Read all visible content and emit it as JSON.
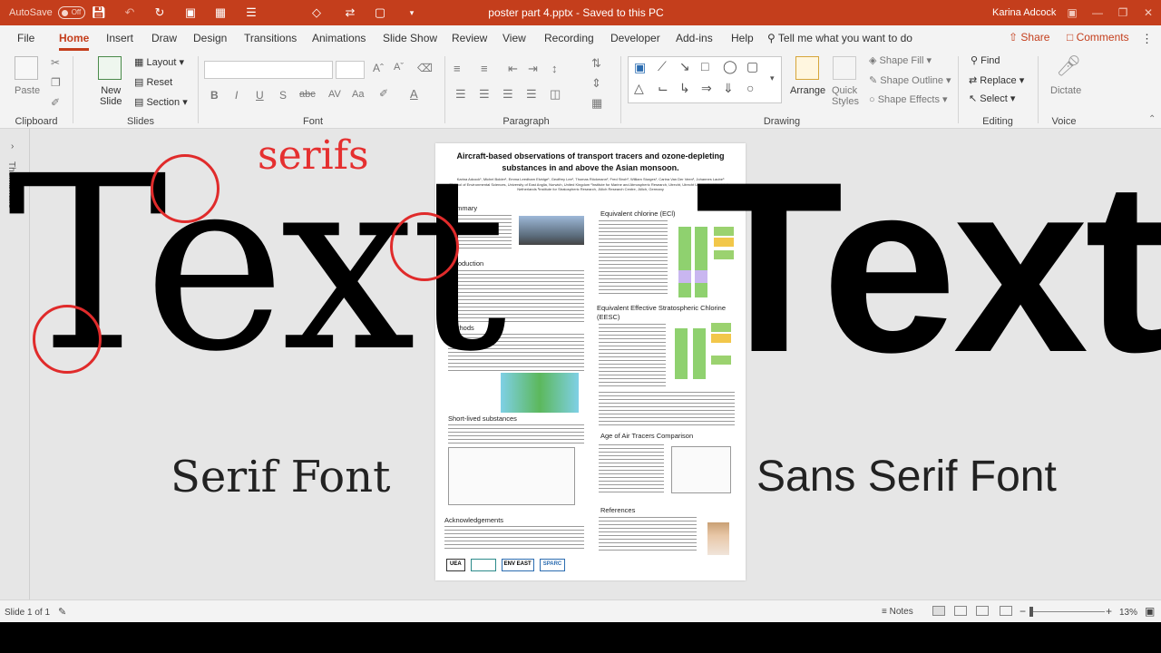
{
  "titlebar": {
    "autosave_label": "AutoSave",
    "autosave_state": "Off",
    "document_title": "poster part 4.pptx  -  Saved to this PC",
    "user_name": "Karina Adcock"
  },
  "tabs": [
    "File",
    "Home",
    "Insert",
    "Draw",
    "Design",
    "Transitions",
    "Animations",
    "Slide Show",
    "Review",
    "View",
    "Recording",
    "Developer",
    "Add-ins",
    "Help"
  ],
  "active_tab": "Home",
  "tell_me": "Tell me what you want to do",
  "share_label": "Share",
  "comments_label": "Comments",
  "ribbon": {
    "groups": {
      "clipboard": "Clipboard",
      "slides": "Slides",
      "font": "Font",
      "paragraph": "Paragraph",
      "drawing": "Drawing",
      "editing": "Editing",
      "voice": "Voice"
    },
    "paste": "Paste",
    "new_slide": "New\nSlide",
    "layout": "Layout",
    "reset": "Reset",
    "section": "Section",
    "arrange": "Arrange",
    "quick_styles": "Quick\nStyles",
    "shape_fill": "Shape Fill",
    "shape_outline": "Shape Outline",
    "shape_effects": "Shape Effects",
    "find": "Find",
    "replace": "Replace",
    "select": "Select",
    "dictate": "Dictate"
  },
  "thumbnails_label": "Thumbnails",
  "poster": {
    "title": "Aircraft-based observations of transport tracers and ozone-depleting substances in and above the Asian monsoon.",
    "authors": "Karina Adcock¹, Michel Bolder¹, Emma Leedham Elvidge¹, Geoffrey Lee¹, Thomas Röckmann², Fred Stroh³, William Sturges¹, Carina Van Der Veen², Johannes Laube³",
    "affiliations": "¹School of Environmental Sciences, University of East Anglia, Norwich, United Kingdom  ²Institute for Marine and Atmospheric Research, Utrecht, Utrecht University, Utrecht, the Netherlands  ³Institute for Stratospheric Research, Jülich Research Centre, Jülich, Germany",
    "sections": {
      "summary": "Summary",
      "introduction": "Introduction",
      "methods": "Methods",
      "short_lived": "Short-lived substances",
      "acknowledgements": "Acknowledgements",
      "ecl": "Equivalent chlorine (ECl)",
      "eesc": "Equivalent Effective Stratospheric Chlorine (EESC)",
      "age": "Age of Air Tracers Comparison",
      "references": "References"
    },
    "logos": [
      "UEA",
      "",
      "ENV EAST",
      "SPARC"
    ]
  },
  "overlay": {
    "serif_word": "Text",
    "sans_word": "Text",
    "serifs_label": "serifs",
    "serif_font_label": "Serif Font",
    "sans_font_label": "Sans Serif Font"
  },
  "status": {
    "slide_count": "Slide 1 of 1",
    "notes": "Notes",
    "zoom": "13%",
    "zoom_level_percent": 13
  },
  "colors": {
    "accent": "#c43e1c",
    "annotation_red": "#e02b2b"
  }
}
